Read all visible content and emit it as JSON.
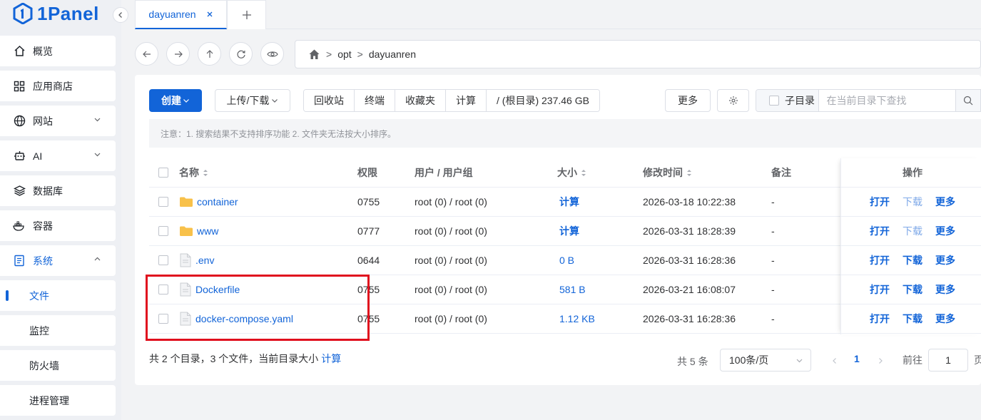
{
  "app": {
    "logo_text": "1Panel"
  },
  "sidebar": {
    "items": [
      {
        "label": "概览",
        "icon": "home-icon"
      },
      {
        "label": "应用商店",
        "icon": "grid-icon"
      },
      {
        "label": "网站",
        "icon": "globe-icon",
        "expandable": true
      },
      {
        "label": "AI",
        "icon": "robot-icon",
        "expandable": true
      },
      {
        "label": "数据库",
        "icon": "layers-icon"
      },
      {
        "label": "容器",
        "icon": "docker-icon"
      },
      {
        "label": "系统",
        "icon": "system-icon",
        "expanded": true
      }
    ],
    "sub_items": [
      {
        "label": "文件",
        "active": true
      },
      {
        "label": "监控"
      },
      {
        "label": "防火墙"
      },
      {
        "label": "进程管理"
      }
    ]
  },
  "tabs": [
    {
      "label": "dayuanren",
      "active": true
    }
  ],
  "path": {
    "segments": [
      "opt",
      "dayuanren"
    ]
  },
  "toolbar": {
    "create": "创建",
    "upload": "上传/下载",
    "group": [
      "回收站",
      "终端",
      "收藏夹",
      "计算",
      "/ (根目录) 237.46 GB"
    ],
    "more": "更多",
    "subdir": "子目录",
    "search_placeholder": "在当前目录下查找"
  },
  "notice": "注意：1. 搜索结果不支持排序功能 2. 文件夹无法按大小排序。",
  "table": {
    "headers": {
      "name": "名称",
      "perm": "权限",
      "user": "用户 / 用户组",
      "size": "大小",
      "mtime": "修改时间",
      "note": "备注",
      "ops": "操作"
    },
    "rows": [
      {
        "name": "container",
        "type": "folder",
        "perm": "0755",
        "user": "root (0) / root (0)",
        "size": "计算",
        "mtime": "2026-03-18 10:22:38",
        "note": "-",
        "open": "打开",
        "download": "下载",
        "more": "更多",
        "download_disabled": true
      },
      {
        "name": "www",
        "type": "folder",
        "perm": "0777",
        "user": "root (0) / root (0)",
        "size": "计算",
        "mtime": "2026-03-31 18:28:39",
        "note": "-",
        "open": "打开",
        "download": "下载",
        "more": "更多",
        "download_disabled": true
      },
      {
        "name": ".env",
        "type": "file",
        "perm": "0644",
        "user": "root (0) / root (0)",
        "size": "0 B",
        "mtime": "2026-03-31 16:28:36",
        "note": "-",
        "open": "打开",
        "download": "下载",
        "more": "更多",
        "download_disabled": false
      },
      {
        "name": "Dockerfile",
        "type": "file",
        "perm": "0755",
        "user": "root (0) / root (0)",
        "size": "581 B",
        "mtime": "2026-03-21 16:08:07",
        "note": "-",
        "open": "打开",
        "download": "下载",
        "more": "更多",
        "download_disabled": false
      },
      {
        "name": "docker-compose.yaml",
        "type": "file",
        "perm": "0755",
        "user": "root (0) / root (0)",
        "size": "1.12 KB",
        "mtime": "2026-03-31 16:28:36",
        "note": "-",
        "open": "打开",
        "download": "下载",
        "more": "更多",
        "download_disabled": false
      }
    ]
  },
  "footer": {
    "summary": "共 2 个目录，3 个文件，当前目录大小",
    "calc": "计算",
    "total": "共 5 条",
    "page_size": "100条/页",
    "current_page": "1",
    "goto_label": "前往",
    "goto_value": "1",
    "page_suffix": "页"
  },
  "colors": {
    "accent": "#1264d8",
    "highlight": "#e0101e",
    "folder": "#f8c14a"
  }
}
